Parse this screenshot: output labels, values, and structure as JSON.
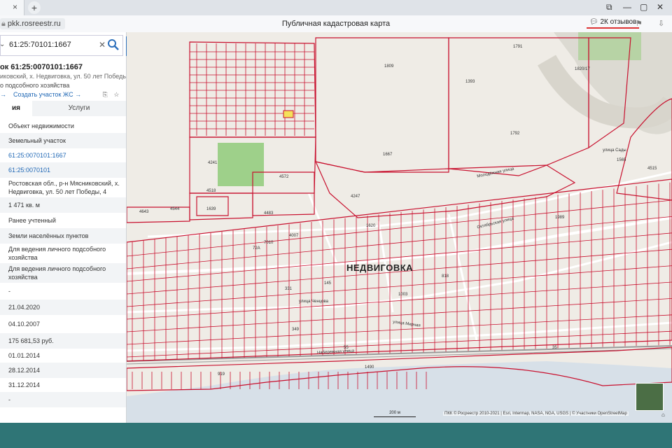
{
  "browser": {
    "tab_close": "×",
    "new_tab": "+",
    "url": "pkk.rosreestr.ru",
    "page_title": "Публичная кадастровая карта",
    "reviews": "2К отзывов"
  },
  "panel": {
    "search_value": "61:25:70101:1667",
    "object_heading": "ок 61:25:0070101:1667",
    "address_short": "иковский, х. Недвиговка, ул. 50 лет Победы, 4",
    "use_short": "о подсобного хозяйства",
    "create_link": "Создать участок ЖС →",
    "tab_info": "ия",
    "tab_services": "Услуги",
    "rows": [
      "Объект недвижимости",
      "Земельный участок",
      "61:25:0070101:1667",
      "61:25:0070101",
      "Ростовская обл., р-н Мясниковский, х. Недвиговка, ул. 50 лет Победы, 4",
      "1 471 кв. м",
      "Ранее учтенный",
      "Земли населённых пунктов",
      "Для ведения личного подсобного хозяйства",
      "Для ведения личного подсобного хозяйства",
      "-",
      "21.04.2020",
      "04.10.2007",
      "175 681,53 руб.",
      "01.01.2014",
      "28.12.2014",
      "31.12.2014",
      "-"
    ]
  },
  "map": {
    "village": "НЕДВИГОВКА",
    "streets": [
      "улица Сады",
      "Молодёжная улица",
      "Октябрьская улица",
      "улица Ченцова",
      "улица Мирная",
      "Набережная улица"
    ],
    "parcels": [
      "1791",
      "1809",
      "1820/17",
      "1393",
      "1792",
      "1667",
      "4241",
      "4572",
      "4518",
      "4643",
      "4544",
      "1639",
      "4483",
      "4247",
      "1620",
      "4007",
      "72А",
      "7010",
      "55",
      "35",
      "1565",
      "4515",
      "1989",
      "1003",
      "818",
      "1490",
      "919",
      "349",
      "331",
      "145"
    ],
    "scale": "200 м",
    "attribution": "ПКК © Росреестр 2010-2021 | Esri, Intermap, NASA, NGA, USGS | © Участники OpenStreetMap"
  },
  "colors": {
    "parcel": "#c8102e",
    "accent": "#2c6fbb",
    "highlight": "#f5e15a"
  }
}
